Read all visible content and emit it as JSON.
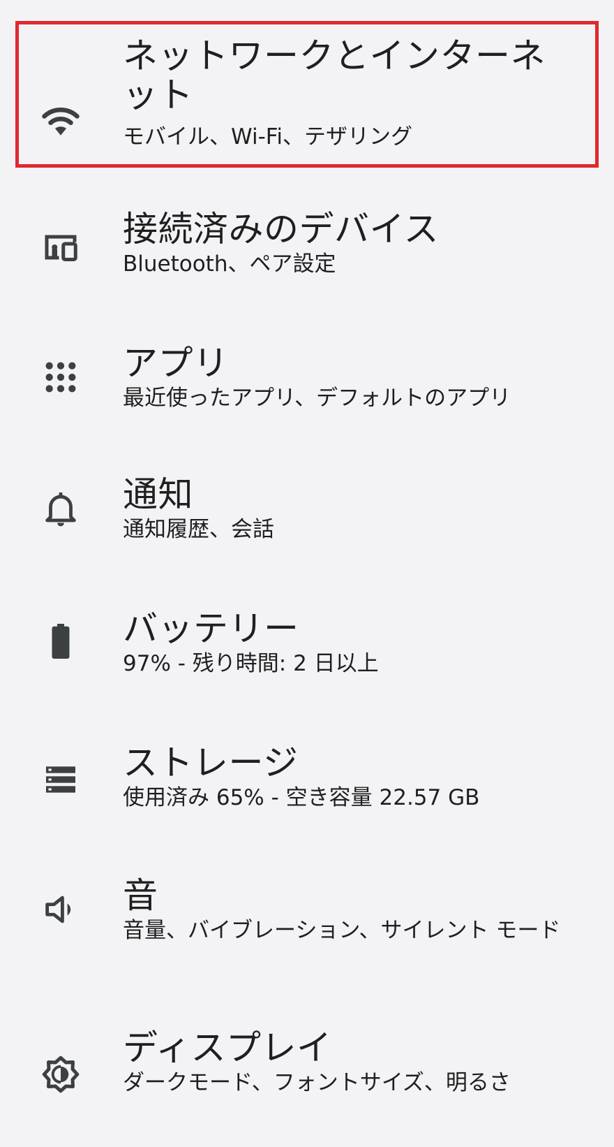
{
  "settings": {
    "items": [
      {
        "title": "ネットワークとインターネット",
        "subtitle": "モバイル、Wi-Fi、テザリング",
        "icon": "wifi-icon"
      },
      {
        "title": "接続済みのデバイス",
        "subtitle": "Bluetooth、ペア設定",
        "icon": "devices-icon"
      },
      {
        "title": "アプリ",
        "subtitle": "最近使ったアプリ、デフォルトのアプリ",
        "icon": "apps-grid-icon"
      },
      {
        "title": "通知",
        "subtitle": "通知履歴、会話",
        "icon": "bell-icon"
      },
      {
        "title": "バッテリー",
        "subtitle": "97% - 残り時間: 2 日以上",
        "icon": "battery-icon"
      },
      {
        "title": "ストレージ",
        "subtitle": "使用済み 65% - 空き容量 22.57 GB",
        "icon": "storage-icon"
      },
      {
        "title": "音",
        "subtitle": "音量、バイブレーション、サイレント モード",
        "icon": "volume-icon"
      },
      {
        "title": "ディスプレイ",
        "subtitle": "ダークモード、フォントサイズ、明るさ",
        "icon": "brightness-icon"
      }
    ]
  },
  "colors": {
    "background": "#f3f3f6",
    "icon": "#3c4043",
    "text": "#1f1f1f",
    "highlight": "#e1282f"
  }
}
